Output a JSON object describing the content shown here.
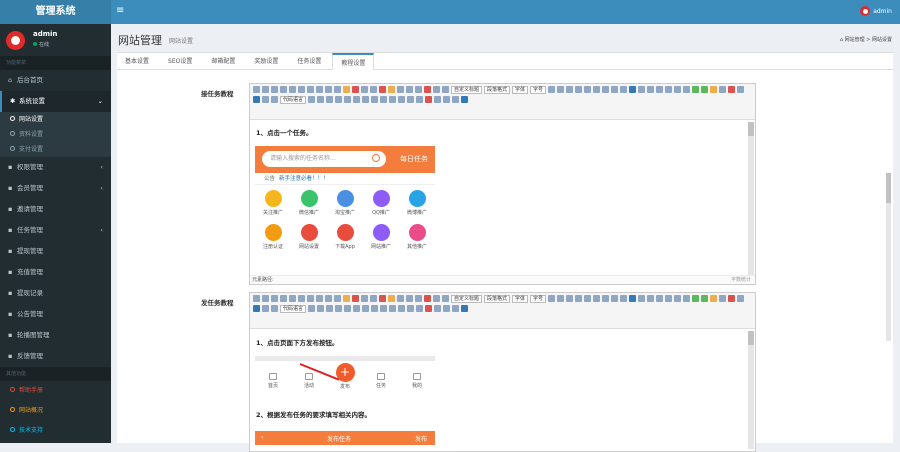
{
  "header": {
    "logo": "管理系统",
    "menu_toggle": "≡",
    "user_name": "admin"
  },
  "sidebar": {
    "user": {
      "name": "admin",
      "status": "在线"
    },
    "header_main": "功能菜单",
    "items": [
      {
        "label": "后台首页",
        "icon": "home-icon"
      },
      {
        "label": "系统设置",
        "icon": "gear-icon",
        "expanded": true
      }
    ],
    "sub_items": [
      {
        "label": "网站设置",
        "active": true
      },
      {
        "label": "资料设置"
      },
      {
        "label": "支付设置"
      }
    ],
    "more_items": [
      {
        "label": "权限管理",
        "icon": "lock-icon",
        "chevron": true
      },
      {
        "label": "会员管理",
        "icon": "user-icon",
        "chevron": true
      },
      {
        "label": "邀请管理",
        "icon": "link-icon",
        "chevron": false
      },
      {
        "label": "任务管理",
        "icon": "task-icon",
        "chevron": true
      },
      {
        "label": "提现管理",
        "icon": "money-icon",
        "chevron": false
      },
      {
        "label": "充值管理",
        "icon": "card-icon",
        "chevron": false
      },
      {
        "label": "提现记录",
        "icon": "list-icon",
        "chevron": false
      },
      {
        "label": "公告管理",
        "icon": "bell-icon",
        "chevron": false
      },
      {
        "label": "轮播图管理",
        "icon": "image-icon",
        "chevron": false
      },
      {
        "label": "反馈管理",
        "icon": "chat-icon",
        "chevron": false
      }
    ],
    "header_other": "其他功能",
    "other_items": [
      {
        "label": "帮助手册",
        "color": "red"
      },
      {
        "label": "网站概况",
        "color": "yellow"
      },
      {
        "label": "技术支持",
        "color": "aqua"
      }
    ]
  },
  "content": {
    "title": "网站管理",
    "subtitle": "网站设置",
    "breadcrumb": [
      "网站管理",
      "网站设置"
    ]
  },
  "tabs": [
    {
      "label": "基本设置",
      "active": false
    },
    {
      "label": "SEO设置",
      "active": false
    },
    {
      "label": "邮箱配置",
      "active": false
    },
    {
      "label": "奖励设置",
      "active": false
    },
    {
      "label": "任务设置",
      "active": false
    },
    {
      "label": "教程设置",
      "active": true
    }
  ],
  "form": {
    "field1_label": "接任务教程",
    "field2_label": "发任务教程"
  },
  "editor": {
    "select_font_family": "字体",
    "select_font_size": "字号",
    "select_paragraph": "段落格式",
    "select_custom_title": "自定义标题",
    "select_code_language": "代码语言",
    "footer_element_path": "元素路径:",
    "footer_word_count": "字数统计"
  },
  "tutorial1": {
    "step": "1、点击一个任务。",
    "search_placeholder": "请输入搜索的任务名称...",
    "task_button": "每日任务",
    "notice_label": "公告",
    "notice_text": "新手注意必看！！！",
    "grid": [
      {
        "label": "关注推广",
        "color": "#f5b61d"
      },
      {
        "label": "微信推广",
        "color": "#3ac36b"
      },
      {
        "label": "淘宝推广",
        "color": "#4a90e2"
      },
      {
        "label": "QQ推广",
        "color": "#8e5cf5"
      },
      {
        "label": "微博推广",
        "color": "#2aa3e6"
      },
      {
        "label": "注册认证",
        "color": "#f39c12"
      },
      {
        "label": "网站设置",
        "color": "#e74c3c"
      },
      {
        "label": "下载App",
        "color": "#e74c3c"
      },
      {
        "label": "网站推广",
        "color": "#8e5cf5"
      },
      {
        "label": "其他推广",
        "color": "#ea4c89"
      }
    ]
  },
  "tutorial2": {
    "step1": "1、点击页面下方发布按钮。",
    "nav": [
      "首页",
      "活动",
      "发布",
      "任务",
      "我的"
    ],
    "step2": "2、根据发布任务的要求填写相关内容。",
    "bar_left": "‹",
    "bar_title": "发布任务",
    "bar_right": "发布"
  },
  "colors": {
    "header_blue": "#3c8dbc",
    "sidebar_bg": "#222d32",
    "accent_orange": "#f47c3c"
  }
}
